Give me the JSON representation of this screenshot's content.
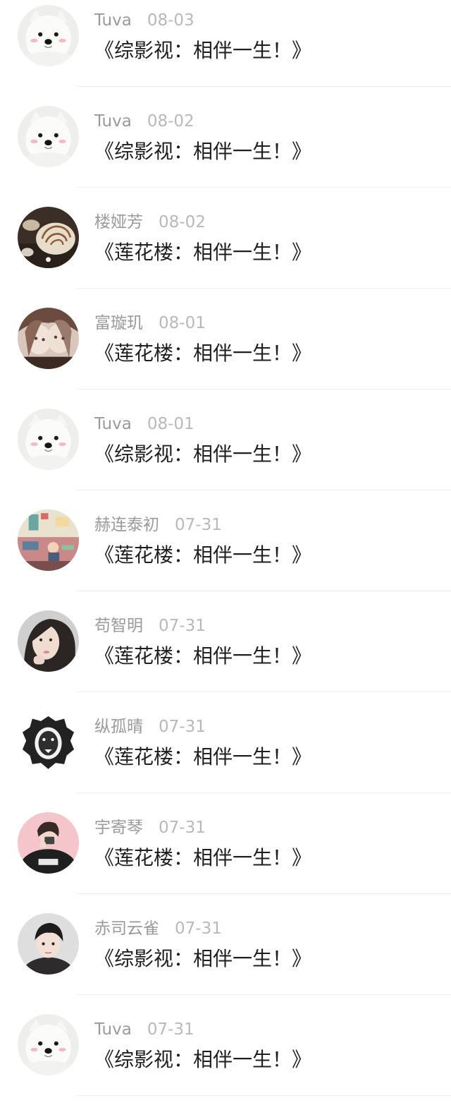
{
  "comments": [
    {
      "author": "Tuva",
      "date": "08-03",
      "text": "《综影视：相伴一生！》",
      "avatar": "samoyed-dog-avatar"
    },
    {
      "author": "Tuva",
      "date": "08-02",
      "text": "《综影视：相伴一生！》",
      "avatar": "samoyed-dog-avatar"
    },
    {
      "author": "楼娅芳",
      "date": "08-02",
      "text": "《莲花楼：相伴一生！》",
      "avatar": "nautilus-shell-avatar"
    },
    {
      "author": "富璇玑",
      "date": "08-01",
      "text": "《莲花楼：相伴一生！》",
      "avatar": "anime-girls-avatar"
    },
    {
      "author": "Tuva",
      "date": "08-01",
      "text": "《综影视：相伴一生！》",
      "avatar": "samoyed-dog-avatar"
    },
    {
      "author": "赫连泰初",
      "date": "07-31",
      "text": "《莲花楼：相伴一生！》",
      "avatar": "illustrated-room-avatar"
    },
    {
      "author": "苟智明",
      "date": "07-31",
      "text": "《莲花楼：相伴一生！》",
      "avatar": "woman-portrait-avatar"
    },
    {
      "author": "纵孤晴",
      "date": "07-31",
      "text": "《莲花楼：相伴一生！》",
      "avatar": "lion-head-avatar"
    },
    {
      "author": "宇寄琴",
      "date": "07-31",
      "text": "《莲花楼：相伴一生！》",
      "avatar": "pink-selfie-avatar"
    },
    {
      "author": "赤司云雀",
      "date": "07-31",
      "text": "《综影视：相伴一生！》",
      "avatar": "young-man-portrait-avatar"
    },
    {
      "author": "Tuva",
      "date": "07-31",
      "text": "《综影视：相伴一生！》",
      "avatar": "samoyed-dog-avatar"
    }
  ]
}
